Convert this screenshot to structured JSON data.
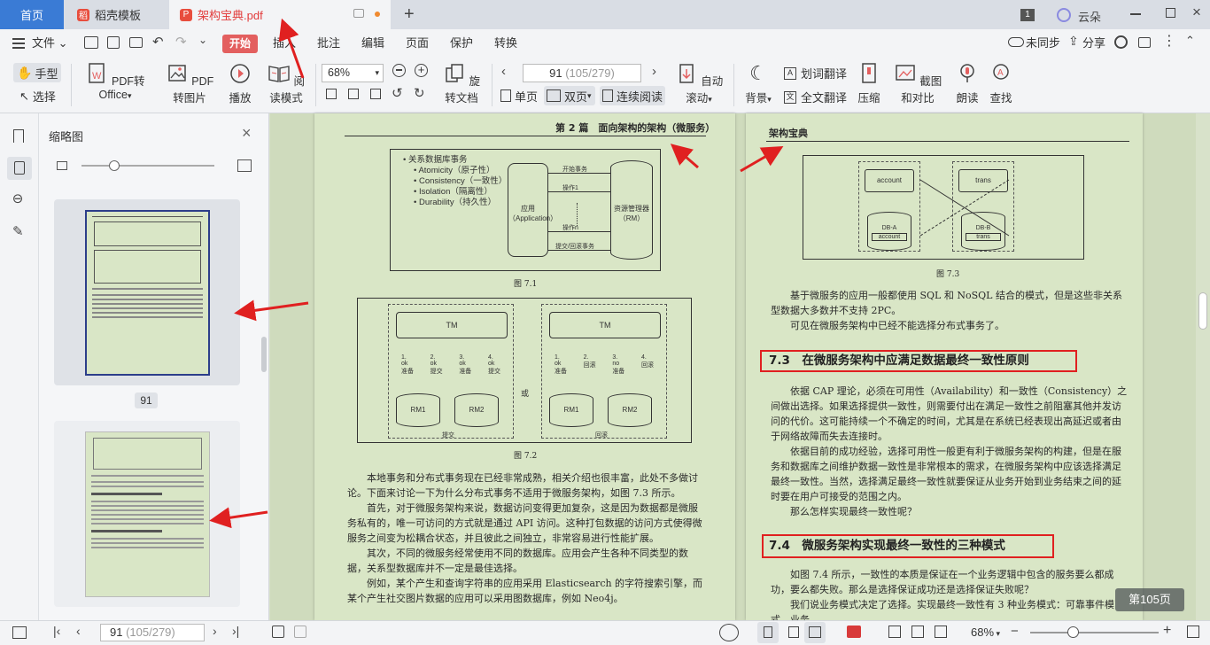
{
  "titlebar": {
    "home_tab": "首页",
    "tabs": [
      {
        "label": "稻壳模板"
      },
      {
        "label": "架构宝典.pdf"
      }
    ],
    "page_indicator": "1",
    "user": "云朵"
  },
  "menu": {
    "file": "文件",
    "items": [
      "开始",
      "插入",
      "批注",
      "编辑",
      "页面",
      "保护",
      "转换"
    ],
    "sync": "未同步",
    "share": "分享"
  },
  "toolbar": {
    "hand": "手型",
    "select": "选择",
    "pdf_to_office": "PDF转Office",
    "pdf_to_image": "PDF转图片",
    "play": "播放",
    "read_mode": "阅读模式",
    "zoom": "68%",
    "rotate": "旋转文档",
    "page_input": "91",
    "page_total": "(105/279)",
    "single": "单页",
    "double": "双页",
    "continuous": "连续阅读",
    "autoscroll": "自动滚动",
    "background": "背景",
    "word_translate": "划词翻译",
    "full_translate": "全文翻译",
    "compress": "压缩",
    "screenshot_compare": "截图和对比",
    "read_aloud": "朗读",
    "find": "查找"
  },
  "sidebar": {
    "title": "缩略图",
    "current_page": "91"
  },
  "left_page": {
    "header": "第 2 篇　面向架构的架构（微服务）",
    "fig71": {
      "heading": "关系数据库事务",
      "bullets": [
        "Atomicity（原子性）",
        "Consistency（一致性）",
        "Isolation（隔离性）",
        "Durability（持久性）"
      ],
      "app": "应用（Application）",
      "rm": "资源管理器（RM）",
      "arrows": [
        "开始事务",
        "操作1",
        "操作n",
        "提交/回滚事务"
      ],
      "caption": "图 7.1"
    },
    "fig72": {
      "tm": "TM",
      "rm1": "RM1",
      "rm2": "RM2",
      "or": "或",
      "left_labels": [
        "1. ok 准备",
        "2. ok 提交",
        "3. ok 准备",
        "4. ok 提交"
      ],
      "right_labels": [
        "1. ok 准备",
        "2. 回滚",
        "3. no 准备",
        "4. 回滚"
      ],
      "left_caption": "提交",
      "right_caption": "回滚",
      "caption": "图 7.2"
    },
    "paragraphs": [
      "　　本地事务和分布式事务现在已经非常成熟，相关介绍也很丰富，此处不多做讨论。下面来讨论一下为什么分布式事务不适用于微服务架构，如图 7.3 所示。",
      "　　首先，对于微服务架构来说，数据访问变得更加复杂，这是因为数据都是微服务私有的，唯一可访问的方式就是通过 API 访问。这种打包数据的访问方式使得微服务之间变为松耦合状态，并且彼此之间独立，非常容易进行性能扩展。",
      "　　其次，不同的微服务经常使用不同的数据库。应用会产生各种不同类型的数据，关系型数据库并不一定是最佳选择。",
      "　　例如，某个产生和查询字符串的应用采用 Elasticsearch 的字符搜索引擎，而某个产生社交图片数据的应用可以采用图数据库，例如 Neo4j。"
    ]
  },
  "right_page": {
    "header": "架构宝典",
    "fig73": {
      "account": "account",
      "trans": "trans",
      "dba": "DB-A",
      "dbb": "DB-B",
      "dba_table": "account",
      "dbb_table": "trans",
      "caption": "图 7.3"
    },
    "para1": "　　基于微服务的应用一般都使用 SQL 和 NoSQL 结合的模式，但是这些非关系型数据大多数并不支持 2PC。",
    "para2": "　　可见在微服务架构中已经不能选择分布式事务了。",
    "section73": "7.3　在微服务架构中应满足数据最终一致性原则",
    "para3": "　　依据 CAP 理论，必须在可用性（Availability）和一致性（Consistency）之间做出选择。如果选择提供一致性，则需要付出在满足一致性之前阻塞其他并发访问的代价。这可能持续一个不确定的时间，尤其是在系统已经表现出高延迟或者由于网络故障而失去连接时。",
    "para4": "　　依据目前的成功经验，选择可用性一般更有利于微服务架构的构建，但是在服务和数据库之间维护数据一致性是非常根本的需求，在微服务架构中应该选择满足最终一致性。当然，选择满足最终一致性就要保证从业务开始到业务结束之间的延时要在用户可接受的范围之内。",
    "para5": "　　那么怎样实现最终一致性呢？",
    "section74": "7.4　微服务架构实现最终一致性的三种模式",
    "para6": "　　如图 7.4 所示，一致性的本质是保证在一个业务逻辑中包含的服务要么都成功，要么都失败。那么是选择保证成功还是选择保证失败呢？",
    "para7": "　　我们说业务模式决定了选择。实现最终一致性有 3 种业务模式：可靠事件模式、业务"
  },
  "page_badge": "第105页",
  "statusbar": {
    "page_input": "91",
    "page_total": "(105/279)",
    "zoom": "68%"
  },
  "colors": {
    "accent": "#e35f5f",
    "home_tab": "#3a7bd5",
    "page_bg": "#d9e6c6",
    "annotation_red": "#e02020"
  }
}
